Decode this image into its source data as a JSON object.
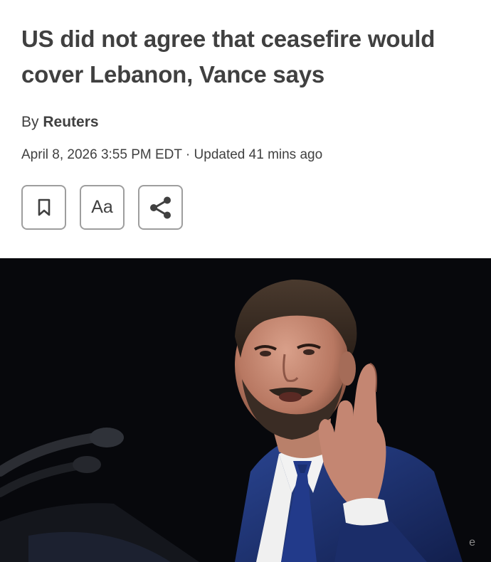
{
  "article": {
    "headline": "US did not agree that ceasefire would cover Lebanon, Vance says",
    "byline_prefix": "By",
    "author": "Reuters",
    "dateline": "April 8, 2026 3:55 PM EDT · Updated 41 mins ago"
  },
  "toolbar": {
    "bookmark_icon": "bookmark-icon",
    "text_size_label": "Aa",
    "share_icon": "share-icon"
  },
  "photo": {
    "credit_fragment": "e"
  },
  "colors": {
    "text": "#404040",
    "button_border": "#9e9e9e",
    "photo_background": "#07080c",
    "suit": "#1f3474"
  }
}
